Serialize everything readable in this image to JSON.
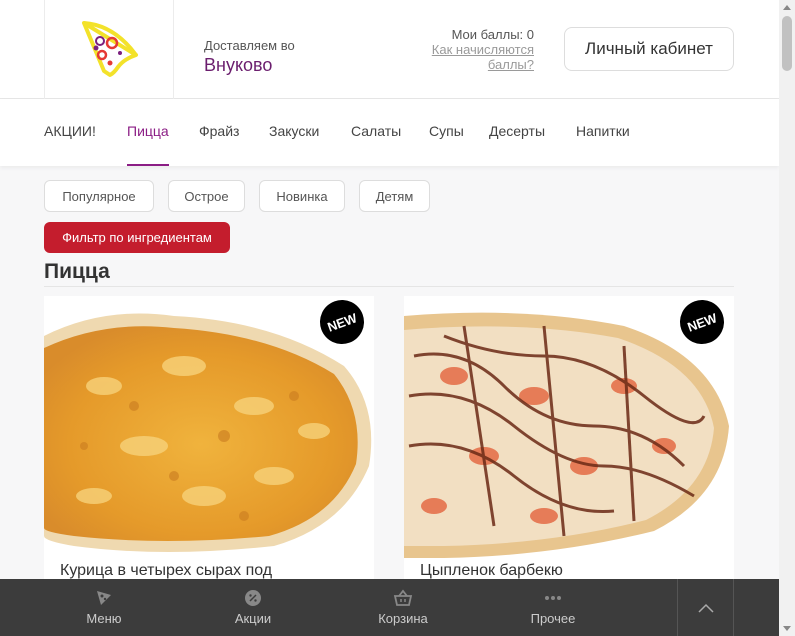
{
  "header": {
    "logo": "pizza-slice-logo",
    "delivery_label": "Доставляем во",
    "delivery_city": "Внуково",
    "points_label": "Мои баллы: 0",
    "points_link": "Как начисляются баллы?",
    "cabinet_button": "Личный кабинет"
  },
  "nav": {
    "items": [
      {
        "label": "АКЦИИ!"
      },
      {
        "label": "Пицца"
      },
      {
        "label": "Фрайз"
      },
      {
        "label": "Закуски"
      },
      {
        "label": "Салаты"
      },
      {
        "label": "Супы"
      },
      {
        "label": "Десерты"
      },
      {
        "label": "Напитки"
      }
    ]
  },
  "chips": [
    {
      "label": "Популярное"
    },
    {
      "label": "Острое"
    },
    {
      "label": "Новинка"
    },
    {
      "label": "Детям"
    }
  ],
  "filter_button": "Фильтр по ингредиентам",
  "section_title": "Пицца",
  "products": [
    {
      "title": "Курица в четырех сырах под",
      "badge": "NEW"
    },
    {
      "title": "Цыпленок барбекю",
      "badge": "NEW"
    }
  ],
  "bottom_bar": {
    "items": [
      {
        "label": "Меню",
        "icon": "pizza-icon"
      },
      {
        "label": "Акции",
        "icon": "discount-icon"
      },
      {
        "label": "Корзина",
        "icon": "basket-icon"
      },
      {
        "label": "Прочее",
        "icon": "more-dots-icon"
      }
    ]
  },
  "colors": {
    "accent": "#8b1d85",
    "filter": "#c41d2d",
    "bottom_bar": "#3c3c3c"
  }
}
